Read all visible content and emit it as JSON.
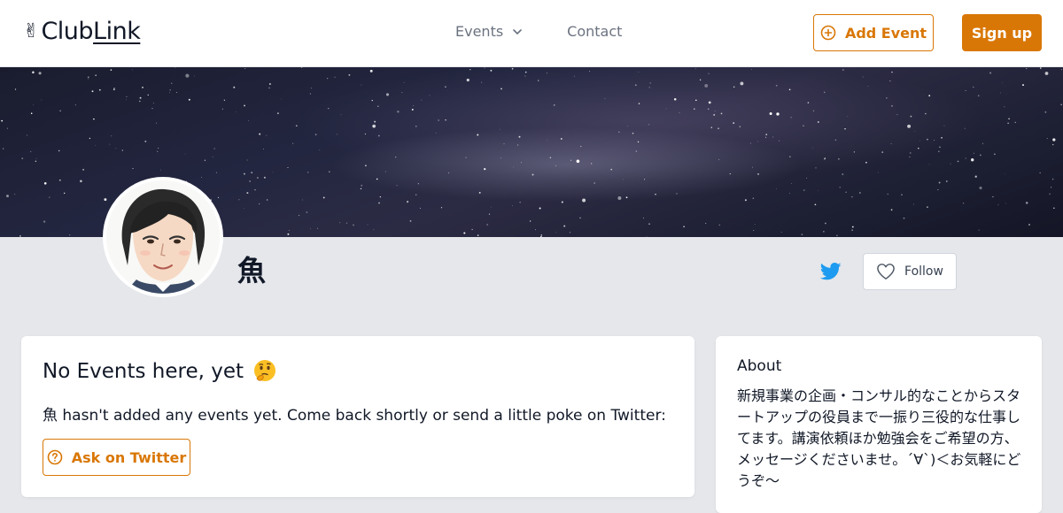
{
  "header": {
    "logo_hand": "✌",
    "logo_club": "Club",
    "logo_link": "Link",
    "nav": {
      "events_label": "Events",
      "contact_label": "Contact"
    },
    "add_event_label": "Add Event",
    "signup_label": "Sign up"
  },
  "profile": {
    "name": "魚",
    "follow_label": "Follow"
  },
  "events_card": {
    "title": "No Events here, yet",
    "message": "魚 hasn't added any events yet. Come back shortly or send a little poke on Twitter:",
    "ask_label": "Ask on Twitter"
  },
  "about_card": {
    "title": "About",
    "text": "新規事業の企画・コンサル的なことからスタートアップの役員まで一振り三役的な仕事してます。講演依頼ほか勉強会をご希望の方、メッセージくださいませ。´∀`)＜お気軽にどうぞ〜"
  },
  "colors": {
    "accent": "#d97706",
    "twitter": "#1d9bf0",
    "background": "#e5e7eb"
  },
  "icons": {
    "events_dropdown": "chevron-down-icon",
    "add_event": "plus-circle-icon",
    "twitter": "twitter-icon",
    "follow": "heart-icon",
    "ask": "question-circle-icon",
    "thinking": "thinking-face-icon"
  }
}
